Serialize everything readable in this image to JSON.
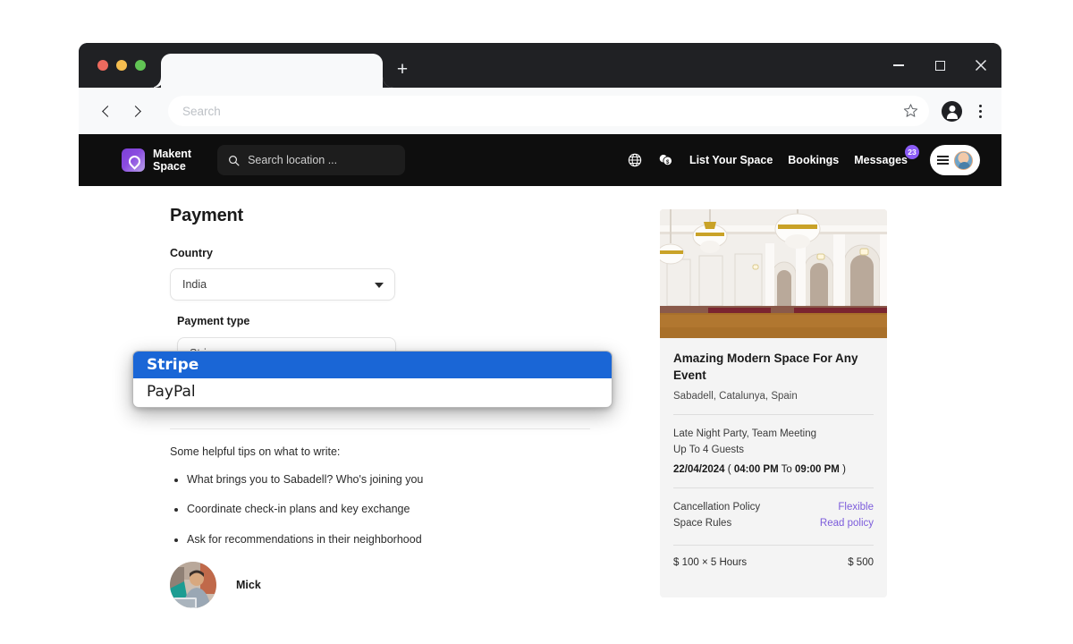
{
  "browser": {
    "tab_title": "",
    "new_tab_label": "+",
    "omnibox_placeholder": "Search",
    "omnibox_value": "",
    "back_icon": "chevron-left-icon",
    "forward_icon": "chevron-right-icon",
    "bookmark_icon": "star-icon",
    "profile_icon": "account-icon",
    "menu_icon": "kebab-menu-icon",
    "minimize_label": "Minimize",
    "maximize_label": "Maximize",
    "close_label": "Close"
  },
  "site_header": {
    "logo_line1": "Makent",
    "logo_line2": "Space",
    "search_placeholder": "Search location ...",
    "search_icon": "search-icon",
    "globe_icon": "globe-icon",
    "coins_icon": "coins-icon",
    "nav": [
      {
        "label": "List Your Space",
        "badge": null
      },
      {
        "label": "Bookings",
        "badge": null
      },
      {
        "label": "Messages",
        "badge": "23"
      }
    ],
    "menu_icon": "hamburger-icon",
    "avatar_icon": "user-avatar-icon"
  },
  "payment": {
    "title": "Payment",
    "country_label": "Country",
    "country_value": "India",
    "payment_type_label": "Payment type",
    "payment_type_value": "Stripe",
    "dropdown_options": [
      {
        "label": "Stripe",
        "selected": true
      },
      {
        "label": "PayPal",
        "selected": false
      }
    ]
  },
  "message": {
    "tips_heading": "Some helpful tips on what to write:",
    "tips": [
      "What brings you to Sabadell? Who's joining you",
      "Coordinate check-in plans and key exchange",
      "Ask for recommendations in their neighborhood"
    ],
    "host_name": "Mick",
    "host_avatar_icon": "host-photo-icon"
  },
  "booking_card": {
    "image_alt": "ornate white ballroom with chandeliers",
    "title": "Amazing Modern Space For Any Event",
    "location": "Sabadell, Catalunya, Spain",
    "space_types": "Late Night Party, Team Meeting",
    "capacity": "Up To 4 Guests",
    "date": "22/04/2024",
    "time_open": "(",
    "time_from": "04:00 PM",
    "time_sep": "To",
    "time_to": "09:00 PM",
    "time_close": ")",
    "cancellation_label": "Cancellation Policy",
    "cancellation_value": "Flexible",
    "rules_label": "Space Rules",
    "rules_value": "Read policy",
    "price_breakdown": "$ 100 × 5 Hours",
    "price_total": "$ 500"
  },
  "colors": {
    "brand_purple": "#8b5cf6",
    "link_purple": "#7c5cdb",
    "header_black": "#0e0e0e",
    "chrome_dark": "#202124",
    "select_highlight": "#1a66d6",
    "card_bg": "#f4f4f4"
  }
}
